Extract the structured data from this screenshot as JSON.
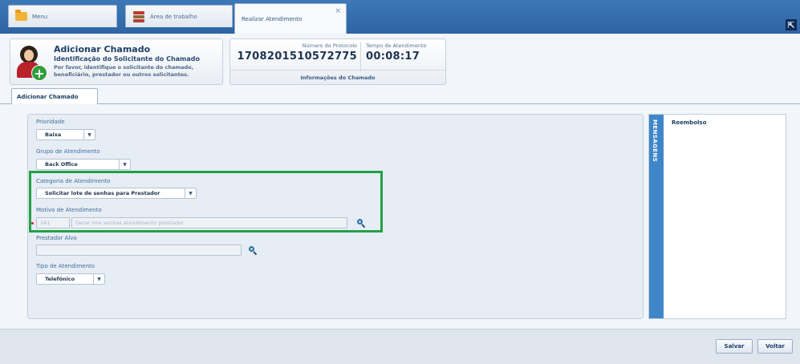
{
  "tabs": [
    {
      "label": "Menu",
      "icon": "folder-icon"
    },
    {
      "label": "Área de trabalho",
      "icon": "stack-icon"
    },
    {
      "label": "Realizar Atendimento",
      "close": "×"
    }
  ],
  "collapse": "⇱",
  "header": {
    "title": "Adicionar Chamado",
    "subtitle": "Identificação do Solicitante do Chamado",
    "description_line1": "Por favor, identifique o solicitante do chamado,",
    "description_line2": "beneficiário, prestador ou outros solicitantes.",
    "protocol_label": "Número do Protocolo",
    "protocol_value": "1708201510572775",
    "time_label": "Tempo de Atendimento",
    "time_value": "00:08:17",
    "info_footer": "Informações do Chamado"
  },
  "subtab": "Adicionar Chamado",
  "form": {
    "prioridade_label": "Prioridade",
    "prioridade_value": "Baixa",
    "grupo_label": "Grupo de Atendimento",
    "grupo_value": "Back Office",
    "categoria_label": "Categoria de Atendimento",
    "categoria_value": "Solicitar lote de senhas para Prestador",
    "motivo_label": "Motivo de Atendimento",
    "motivo_code": "241",
    "motivo_desc": "Gerar lote senhas atendimento prestador",
    "prestador_label": "Prestador Alvo",
    "prestador_value": "",
    "tipo_label": "Tipo de Atendimento",
    "tipo_value": "Telefônico",
    "dropdown_arrow": "▼"
  },
  "side": {
    "strip_label": "MENSAGENS",
    "title": "Reembolso"
  },
  "buttons": {
    "save": "Salvar",
    "back": "Voltar"
  },
  "colors": {
    "highlight": "#22a046",
    "tabbar": "#2e64a3"
  }
}
